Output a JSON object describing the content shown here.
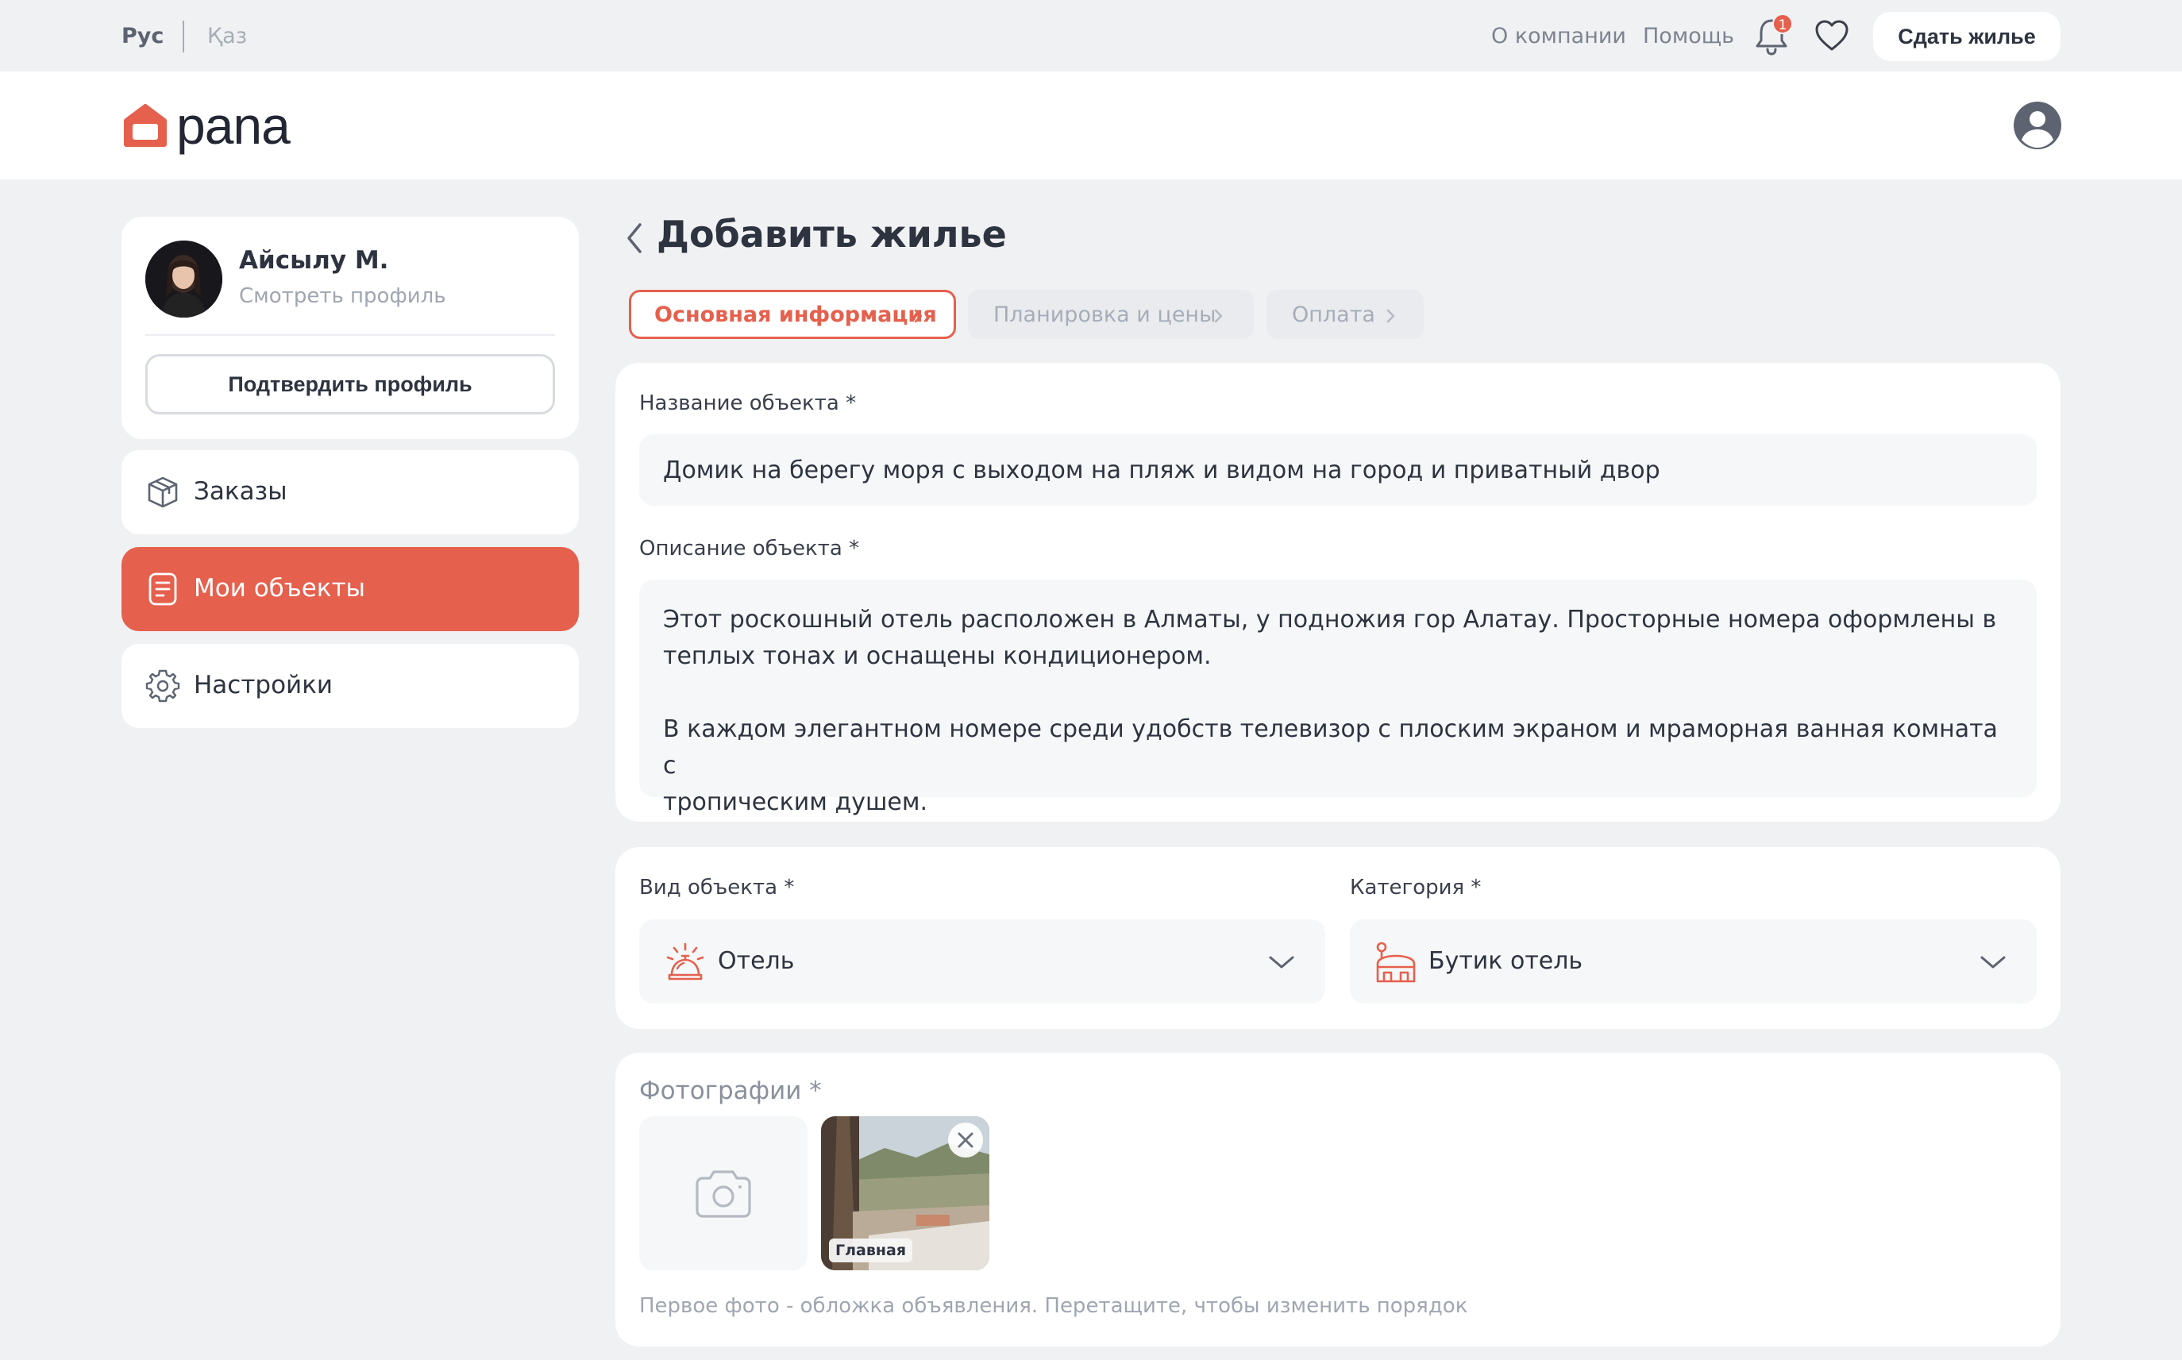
{
  "topbar": {
    "lang_ru": "Рус",
    "lang_kz": "Қаз",
    "about": "О компании",
    "help": "Помощь",
    "notifications_count": "1",
    "rent_button": "Сдать жилье"
  },
  "header": {
    "logo_text": "pana"
  },
  "profile": {
    "name": "Айсылу М.",
    "view_profile": "Смотреть профиль",
    "confirm_button": "Подтвердить профиль"
  },
  "sidebar": {
    "items": [
      {
        "label": "Заказы",
        "icon": "box-icon"
      },
      {
        "label": "Мои объекты",
        "icon": "document-icon",
        "active": true
      },
      {
        "label": "Настройки",
        "icon": "gear-icon"
      }
    ]
  },
  "page": {
    "title": "Добавить жилье"
  },
  "steps": [
    {
      "label": "Основная информация",
      "active": true
    },
    {
      "label": "Планировка и цены",
      "active": false
    },
    {
      "label": "Оплата",
      "active": false
    }
  ],
  "form": {
    "title_label": "Название объекта *",
    "title_value": "Домик на берегу моря с выходом на пляж и видом на город и приватный двор",
    "description_label": "Описание объекта *",
    "description_value": "Этот роскошный отель расположен в Алматы, у подножия гор Алатау. Просторные номера оформлены в\nтеплых тонах и оснащены кондиционером.\n\nВ каждом элегантном номере среди удобств телевизор с плоским экраном и мраморная ванная комната с\nтропическим душем.",
    "type_label": "Вид объекта *",
    "type_value": "Отель",
    "category_label": "Категория *",
    "category_value": "Бутик отель",
    "photos_label": "Фотографии *",
    "photo_main_tag": "Главная",
    "photos_hint": "Первое фото - обложка объявления. Перетащите, чтобы изменить порядок"
  },
  "colors": {
    "accent": "#e5604d",
    "background": "#f0f1f3",
    "card": "#ffffff",
    "field": "#f6f7f8"
  }
}
